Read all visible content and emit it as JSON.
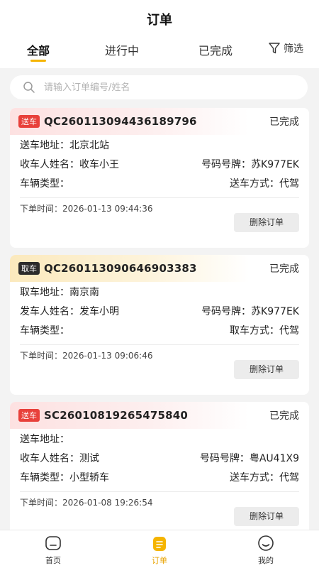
{
  "header": {
    "title": "订单",
    "tabs": [
      "全部",
      "进行中",
      "已完成"
    ],
    "active_tab": "全部",
    "filter_label": "筛选"
  },
  "search": {
    "placeholder": "请输入订单编号/姓名",
    "value": ""
  },
  "orders": [
    {
      "tag": "送车",
      "order_no": "QC2601130944361897 96",
      "status": "已完成",
      "address_label": "送车地址：",
      "address": "北京北站",
      "name_label": "收车人姓名：",
      "name": "收车小王",
      "plate_label": "号码号牌：",
      "plate": "苏K977EK",
      "vehicle_type_label": "车辆类型：",
      "vehicle_type": "",
      "method_label": "送车方式：",
      "method": "代驾",
      "time_label": "下单时间：",
      "time": "2026-01-13 09:44:36",
      "delete_label": "删除订单"
    },
    {
      "tag": "取车",
      "order_no": "QC260113090646903383",
      "status": "已完成",
      "address_label": "取车地址：",
      "address": "南京南",
      "name_label": "发车人姓名：",
      "name": "发车小明",
      "plate_label": "号码号牌：",
      "plate": "苏K977EK",
      "vehicle_type_label": "车辆类型：",
      "vehicle_type": "",
      "method_label": "取车方式：",
      "method": "代驾",
      "time_label": "下单时间：",
      "time": "2026-01-13 09:06:46",
      "delete_label": "删除订单"
    },
    {
      "tag": "送车",
      "order_no": "SC26010819265475840",
      "status": "已完成",
      "address_label": "送车地址：",
      "address": "",
      "name_label": "收车人姓名：",
      "name": "测试",
      "plate_label": "号码号牌：",
      "plate": "粤AU41X9",
      "vehicle_type_label": "车辆类型：",
      "vehicle_type": "小型轿车",
      "method_label": "送车方式：",
      "method": "代驾",
      "time_label": "下单时间：",
      "time": "2026-01-08 19:26:54",
      "delete_label": "删除订单"
    }
  ],
  "bottom_nav": {
    "items": [
      {
        "label": "首页",
        "icon": "home-icon"
      },
      {
        "label": "订单",
        "icon": "order-icon"
      },
      {
        "label": "我的",
        "icon": "profile-icon"
      }
    ],
    "active": "订单"
  },
  "colors": {
    "accent": "#f5b400",
    "tag_red": "#e8403a",
    "tag_dark": "#2b2b2b"
  }
}
